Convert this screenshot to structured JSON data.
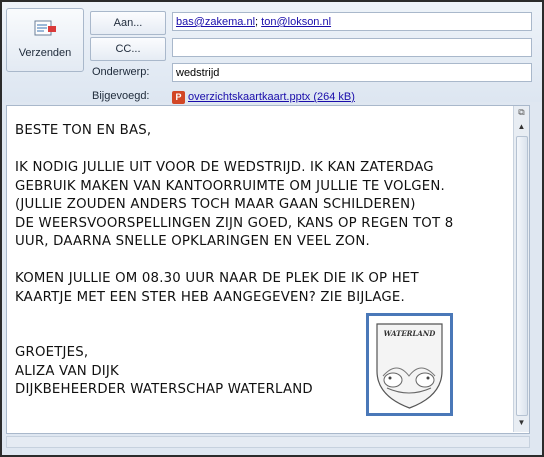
{
  "toolbar": {
    "send_label": "Verzenden"
  },
  "fields": {
    "to_button": "Aan...",
    "to_value_1": "bas@zakema.nl",
    "to_separator": "; ",
    "to_value_2": "ton@lokson.nl",
    "cc_button": "CC...",
    "cc_value": "",
    "subject_label": "Onderwerp:",
    "subject_value": "wedstrijd",
    "attached_label": "Bijgevoegd:",
    "attachment_icon": "powerpoint-icon",
    "attachment_icon_letter": "P",
    "attachment_name": "overzichtskaartkaart.pptx (264 kB)"
  },
  "message": {
    "greeting": "BESTE TON EN BAS,",
    "paragraph_1": "IK NODIG JULLIE UIT VOOR DE WEDSTRIJD. IK KAN ZATERDAG\nGEBRUIK MAKEN VAN KANTOORRUIMTE OM JULLIE TE VOLGEN.\n(JULLIE ZOUDEN ANDERS TOCH MAAR GAAN SCHILDEREN)\nDE WEERSVOORSPELLINGEN ZIJN GOED, KANS OP REGEN TOT 8\nUUR, DAARNA SNELLE OPKLARINGEN EN VEEL ZON.",
    "paragraph_2": "KOMEN JULLIE OM 08.30 UUR NAAR DE PLEK DIE IK OP HET\nKAARTJE MET EEN STER HEB AANGEGEVEN? ZIE BIJLAGE.",
    "closing": "GROETJES,",
    "name": "ALIZA VAN DIJK",
    "role": "DIJKBEHEERDER WATERSCHAP WATERLAND",
    "emblem_text": "WATERLAND"
  },
  "colors": {
    "link": "#1a0dab",
    "emblem_border": "#4a78b8",
    "ppt": "#d24726"
  }
}
